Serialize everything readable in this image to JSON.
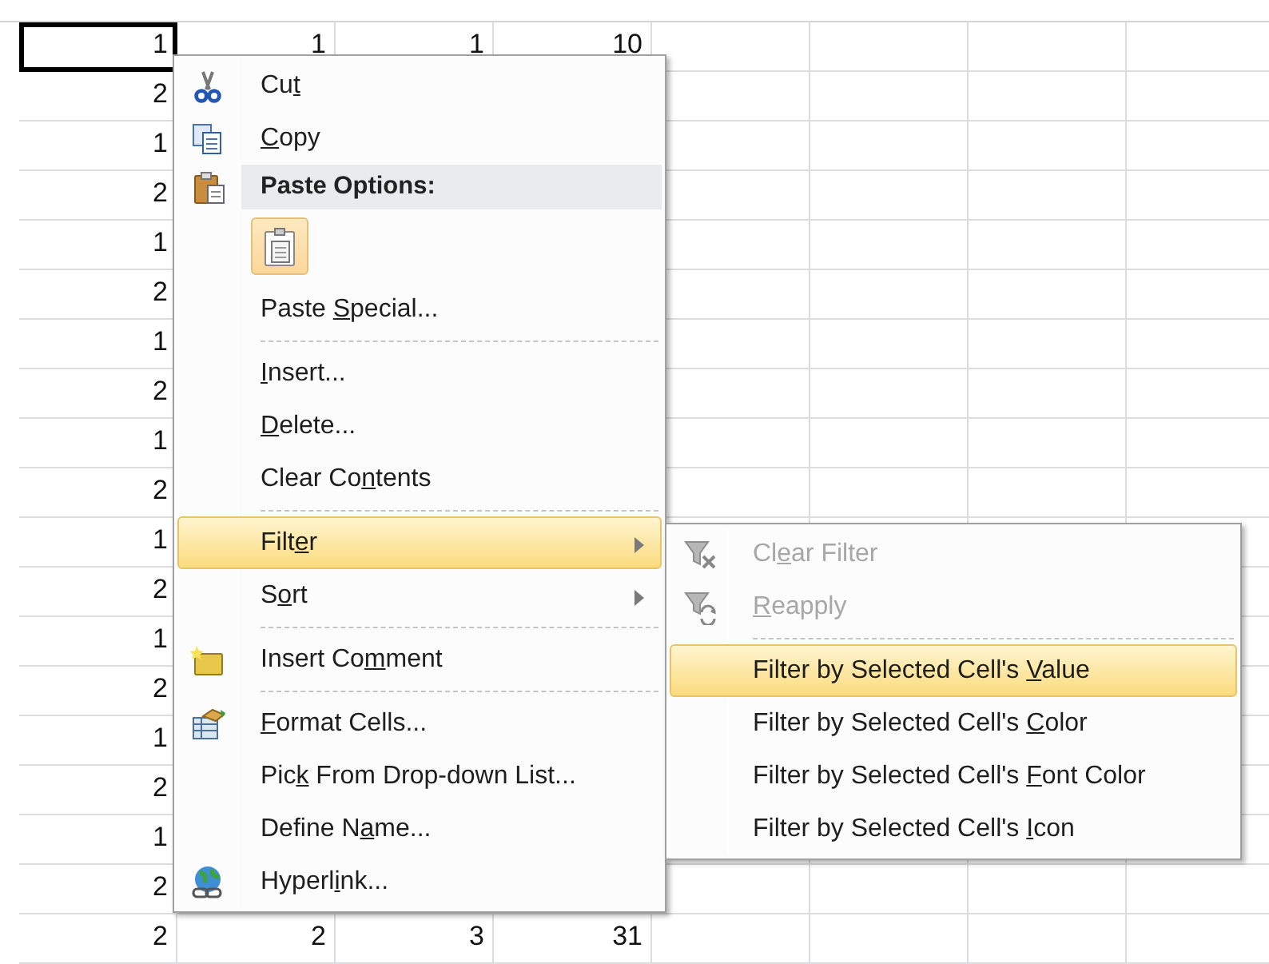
{
  "sheet": {
    "rows": [
      {
        "cells": [
          {
            "value": "1",
            "selected": true
          },
          {
            "value": "1",
            "selected": false
          },
          {
            "value": "1",
            "selected": false
          },
          {
            "value": "10",
            "selected": false
          }
        ]
      },
      {
        "cells": [
          {
            "value": "2",
            "selected": false
          }
        ]
      },
      {
        "cells": [
          {
            "value": "1",
            "selected": false
          }
        ]
      },
      {
        "cells": [
          {
            "value": "2",
            "selected": false
          }
        ]
      },
      {
        "cells": [
          {
            "value": "1",
            "selected": false
          }
        ]
      },
      {
        "cells": [
          {
            "value": "2",
            "selected": false
          }
        ]
      },
      {
        "cells": [
          {
            "value": "1",
            "selected": false
          }
        ]
      },
      {
        "cells": [
          {
            "value": "2",
            "selected": false
          }
        ]
      },
      {
        "cells": [
          {
            "value": "1",
            "selected": false
          }
        ]
      },
      {
        "cells": [
          {
            "value": "2",
            "selected": false
          }
        ]
      },
      {
        "cells": [
          {
            "value": "1",
            "selected": false
          }
        ]
      },
      {
        "cells": [
          {
            "value": "2",
            "selected": false
          }
        ]
      },
      {
        "cells": [
          {
            "value": "1",
            "selected": false
          }
        ]
      },
      {
        "cells": [
          {
            "value": "2",
            "selected": false
          }
        ]
      },
      {
        "cells": [
          {
            "value": "1",
            "selected": false
          }
        ]
      },
      {
        "cells": [
          {
            "value": "2",
            "selected": false
          }
        ]
      },
      {
        "cells": [
          {
            "value": "1",
            "selected": false
          }
        ]
      },
      {
        "cells": [
          {
            "value": "2",
            "selected": false
          }
        ]
      },
      {
        "cells": [
          {
            "value": "2",
            "selected": false
          },
          {
            "value": "2",
            "selected": false
          },
          {
            "value": "3",
            "selected": false
          },
          {
            "value": "31",
            "selected": false
          }
        ]
      }
    ]
  },
  "context_menu": {
    "items": [
      {
        "kind": "item",
        "text": "Cu",
        "access_key": "t",
        "selected": false,
        "has_submenu": false
      },
      {
        "kind": "item",
        "access_key": "C",
        "text_after": "opy",
        "selected": false,
        "has_submenu": false
      },
      {
        "kind": "header",
        "text": "Paste Options:"
      },
      {
        "kind": "paste_buttons"
      },
      {
        "kind": "item",
        "text": "Paste ",
        "access_key": "S",
        "text_after": "pecial...",
        "selected": false,
        "has_submenu": false
      },
      {
        "kind": "item",
        "separator_before": true,
        "access_key": "I",
        "text_after": "nsert...",
        "selected": false,
        "has_submenu": false
      },
      {
        "kind": "item",
        "access_key": "D",
        "text_after": "elete...",
        "selected": false,
        "has_submenu": false
      },
      {
        "kind": "item",
        "text": "Clear Co",
        "access_key": "n",
        "text_after": "tents",
        "selected": false,
        "has_submenu": false
      },
      {
        "kind": "item",
        "separator_before": true,
        "text": "Filt",
        "access_key": "e",
        "text_after": "r",
        "selected": true,
        "has_submenu": true
      },
      {
        "kind": "item",
        "text": "S",
        "access_key": "o",
        "text_after": "rt",
        "selected": false,
        "has_submenu": true
      },
      {
        "kind": "item",
        "separator_before": true,
        "text": "Insert Co",
        "access_key": "m",
        "text_after": "ment",
        "selected": false,
        "has_submenu": false
      },
      {
        "kind": "item",
        "separator_before": true,
        "access_key": "F",
        "text_after": "ormat Cells...",
        "selected": false,
        "has_submenu": false
      },
      {
        "kind": "item",
        "text": "Pic",
        "access_key": "k",
        "text_after": " From Drop-down List...",
        "selected": false,
        "has_submenu": false
      },
      {
        "kind": "item",
        "text": "Define N",
        "access_key": "a",
        "text_after": "me...",
        "selected": false,
        "has_submenu": false
      },
      {
        "kind": "item",
        "text": "Hyperl",
        "access_key": "i",
        "text_after": "nk...",
        "selected": false,
        "has_submenu": false
      }
    ]
  },
  "filter_submenu": {
    "items": [
      {
        "text": "Cl",
        "access_key": "e",
        "text_after": "ar Filter",
        "disabled": true,
        "selected": false
      },
      {
        "access_key": "R",
        "text_after": "eapply",
        "disabled": true,
        "selected": false
      },
      {
        "separator_before": true,
        "text": "Filter by Selected Cell's ",
        "access_key": "V",
        "text_after": "alue",
        "disabled": false,
        "selected": true
      },
      {
        "text": "Filter by Selected Cell's ",
        "access_key": "C",
        "text_after": "olor",
        "disabled": false,
        "selected": false
      },
      {
        "text": "Filter by Selected Cell's ",
        "access_key": "F",
        "text_after": "ont Color",
        "disabled": false,
        "selected": false
      },
      {
        "text": "Filter by Selected Cell's ",
        "access_key": "I",
        "text_after": "con",
        "disabled": false,
        "selected": false
      }
    ]
  }
}
